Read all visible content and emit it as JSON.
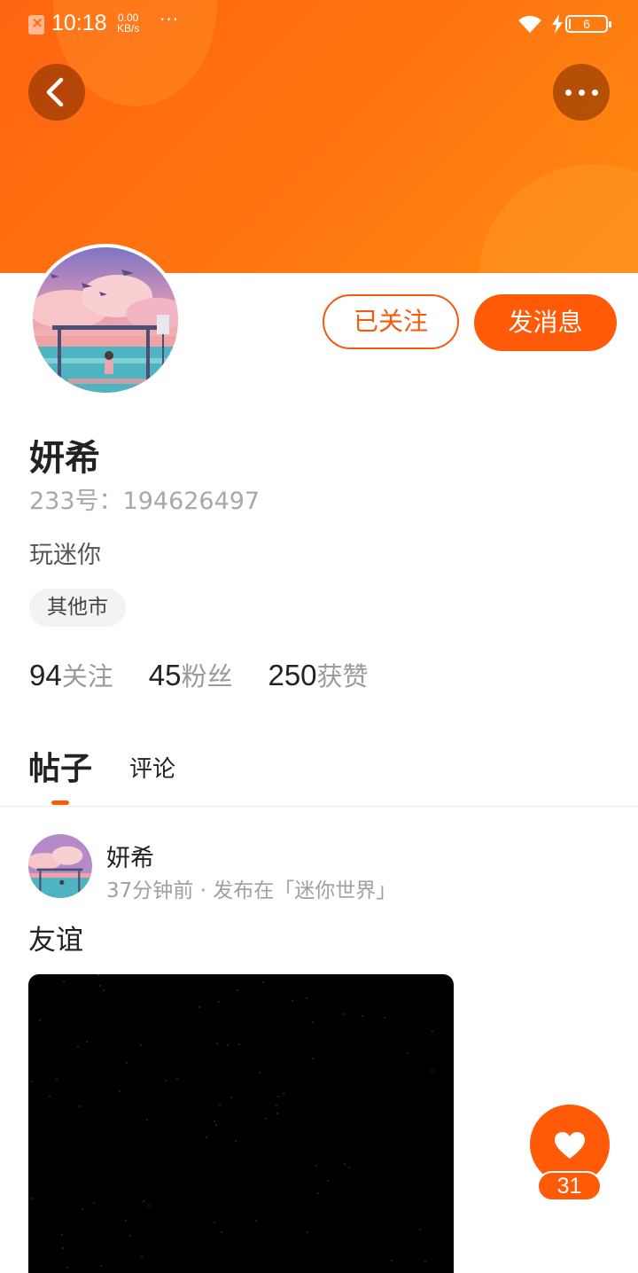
{
  "status_bar": {
    "time": "10:18",
    "net_speed_value": "0.00",
    "net_speed_unit": "KB/s",
    "overflow": "···",
    "battery_level": "6",
    "battery_fraction": 0.06,
    "icons": [
      "sim-error-icon",
      "wifi-icon",
      "charging-icon",
      "battery-icon"
    ]
  },
  "header": {
    "back_icon": "chevron-left-icon",
    "more_icon": "more-horizontal-icon",
    "gradient_start": "#ff6410",
    "gradient_end": "#ff8a12"
  },
  "profile": {
    "name": "妍希",
    "uid_text": "233号：194626497",
    "bio": "玩迷你",
    "location_tag": "其他市",
    "follow_button": "已关注",
    "message_button": "发消息",
    "stats": [
      {
        "value": "94",
        "label": "关注"
      },
      {
        "value": "45",
        "label": "粉丝"
      },
      {
        "value": "250",
        "label": "获赞"
      }
    ]
  },
  "tabs": {
    "posts": "帖子",
    "comments": "评论",
    "active": "posts"
  },
  "post": {
    "author": "妍希",
    "meta": "37分钟前 · 发布在「迷你世界」",
    "text": "友谊"
  },
  "like_fab": {
    "icon": "heart-icon",
    "count": "31"
  },
  "colors": {
    "accent": "#ff5a08",
    "text_primary": "#222222",
    "text_secondary": "#a0a0a0"
  }
}
